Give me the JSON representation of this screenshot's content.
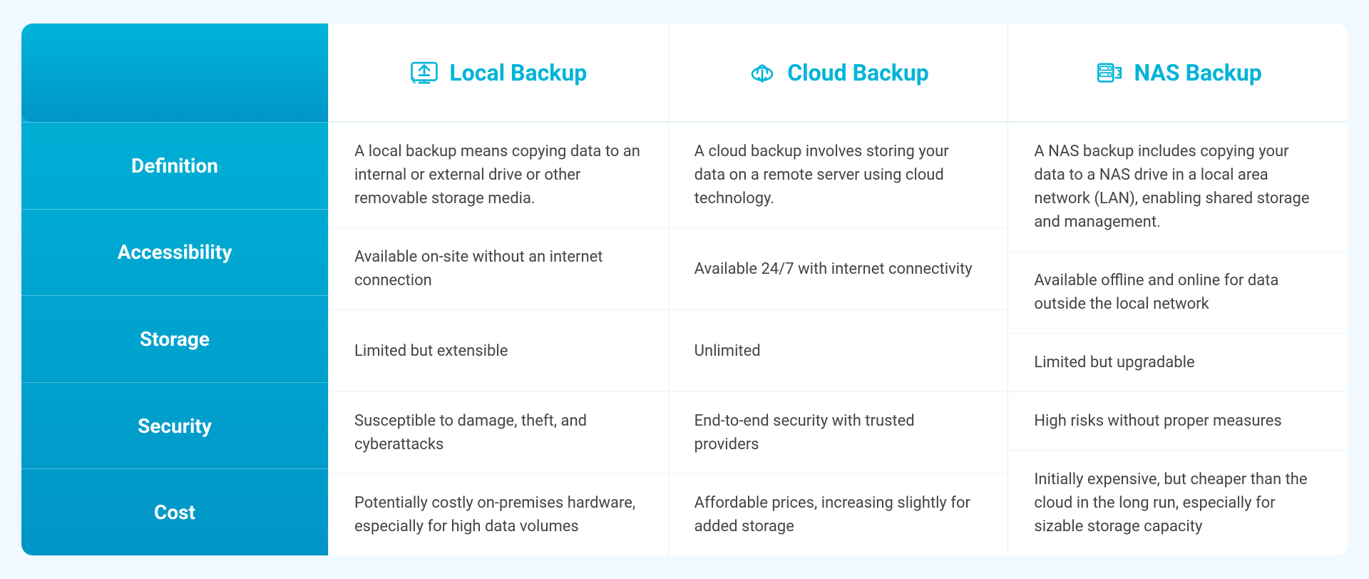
{
  "labels": {
    "definition": "Definition",
    "accessibility": "Accessibility",
    "storage": "Storage",
    "security": "Security",
    "cost": "Cost"
  },
  "columns": [
    {
      "id": "local",
      "title": "Local Backup",
      "icon": "local-backup-icon",
      "definition": "A local backup means copying data to an internal or external drive or other removable storage media.",
      "accessibility": "Available on-site without an internet connection",
      "storage": "Limited but extensible",
      "security": "Susceptible to damage, theft, and cyberattacks",
      "cost": "Potentially costly on-premises hardware, especially for high data volumes"
    },
    {
      "id": "cloud",
      "title": "Cloud Backup",
      "icon": "cloud-backup-icon",
      "definition": "A cloud backup involves storing your data on a remote server using cloud technology.",
      "accessibility": "Available 24/7 with internet connectivity",
      "storage": "Unlimited",
      "security": "End-to-end security with trusted providers",
      "cost": "Affordable prices, increasing slightly for added storage"
    },
    {
      "id": "nas",
      "title": "NAS Backup",
      "icon": "nas-backup-icon",
      "definition": "A NAS backup includes copying your data to a NAS drive in a local area network (LAN), enabling shared storage and management.",
      "accessibility": "Available offline and online for data outside the local network",
      "storage": "Limited but upgradable",
      "security": "High risks without proper measures",
      "cost": "Initially expensive, but cheaper than the cloud in the long run, especially for sizable storage capacity"
    }
  ]
}
